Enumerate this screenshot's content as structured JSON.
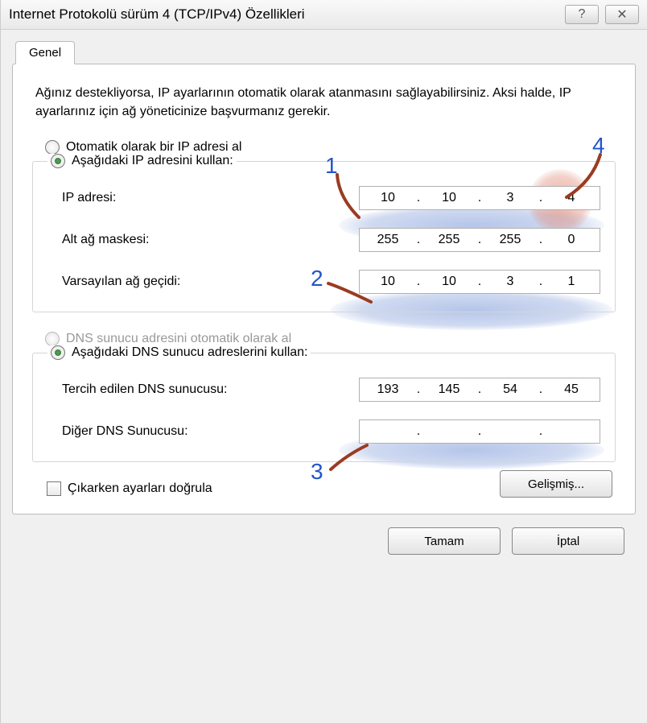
{
  "title": "Internet Protokolü sürüm 4 (TCP/IPv4) Özellikleri",
  "tab": "Genel",
  "desc": "Ağınız destekliyorsa, IP ayarlarının otomatik olarak atanmasını sağlayabilirsiniz. Aksi halde, IP ayarlarınız için ağ yöneticinize başvurmanız gerekir.",
  "radios": {
    "auto_ip": "Otomatik olarak bir IP adresi al",
    "manual_ip": "Aşağıdaki IP adresini kullan:",
    "auto_dns": "DNS sunucu adresini otomatik olarak al",
    "manual_dns": "Aşağıdaki DNS sunucu adreslerini kullan:"
  },
  "fields": {
    "ip_label": "IP adresi:",
    "ip": {
      "o1": "10",
      "o2": "10",
      "o3": "3",
      "o4": "4"
    },
    "mask_label": "Alt ağ maskesi:",
    "mask": {
      "o1": "255",
      "o2": "255",
      "o3": "255",
      "o4": "0"
    },
    "gw_label": "Varsayılan ağ geçidi:",
    "gw": {
      "o1": "10",
      "o2": "10",
      "o3": "3",
      "o4": "1"
    },
    "dns1_label": "Tercih edilen DNS sunucusu:",
    "dns1": {
      "o1": "193",
      "o2": "145",
      "o3": "54",
      "o4": "45"
    },
    "dns2_label": "Diğer DNS Sunucusu:",
    "dns2": {
      "o1": "",
      "o2": "",
      "o3": "",
      "o4": ""
    }
  },
  "validate": "Çıkarken ayarları doğrula",
  "buttons": {
    "advanced": "Gelişmiş...",
    "ok": "Tamam",
    "cancel": "İptal"
  },
  "annots": {
    "n1": "1",
    "n2": "2",
    "n3": "3",
    "n4": "4"
  }
}
